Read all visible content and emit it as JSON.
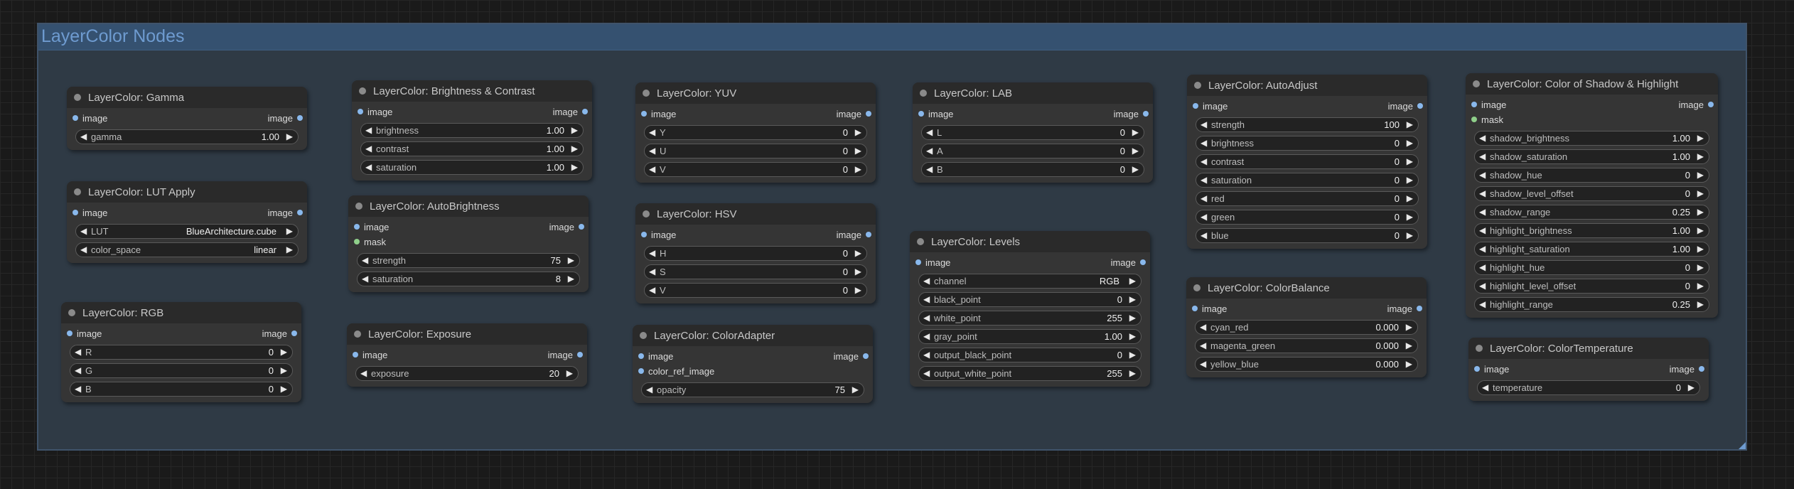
{
  "group": {
    "title": "LayerColor Nodes",
    "color": "#355170"
  },
  "nodes": {
    "gamma": {
      "title": "LayerColor: Gamma",
      "inputs": [
        {
          "label": "image",
          "color": "blue"
        }
      ],
      "output": "image",
      "widgets": [
        {
          "name": "gamma",
          "value": "1.00"
        }
      ]
    },
    "lut": {
      "title": "LayerColor: LUT Apply",
      "inputs": [
        {
          "label": "image",
          "color": "blue"
        }
      ],
      "output": "image",
      "widgets": [
        {
          "name": "LUT",
          "value": "BlueArchitecture.cube"
        },
        {
          "name": "color_space",
          "value": "linear"
        }
      ]
    },
    "rgb": {
      "title": "LayerColor: RGB",
      "inputs": [
        {
          "label": "image",
          "color": "blue"
        }
      ],
      "output": "image",
      "widgets": [
        {
          "name": "R",
          "value": "0"
        },
        {
          "name": "G",
          "value": "0"
        },
        {
          "name": "B",
          "value": "0"
        }
      ]
    },
    "brightness_contrast": {
      "title": "LayerColor: Brightness & Contrast",
      "inputs": [
        {
          "label": "image",
          "color": "blue"
        }
      ],
      "output": "image",
      "widgets": [
        {
          "name": "brightness",
          "value": "1.00"
        },
        {
          "name": "contrast",
          "value": "1.00"
        },
        {
          "name": "saturation",
          "value": "1.00"
        }
      ]
    },
    "autobrightness": {
      "title": "LayerColor: AutoBrightness",
      "inputs": [
        {
          "label": "image",
          "color": "blue"
        },
        {
          "label": "mask",
          "color": "green"
        }
      ],
      "output": "image",
      "widgets": [
        {
          "name": "strength",
          "value": "75"
        },
        {
          "name": "saturation",
          "value": "8"
        }
      ]
    },
    "exposure": {
      "title": "LayerColor: Exposure",
      "inputs": [
        {
          "label": "image",
          "color": "blue"
        }
      ],
      "output": "image",
      "widgets": [
        {
          "name": "exposure",
          "value": "20"
        }
      ]
    },
    "yuv": {
      "title": "LayerColor: YUV",
      "inputs": [
        {
          "label": "image",
          "color": "blue"
        }
      ],
      "output": "image",
      "widgets": [
        {
          "name": "Y",
          "value": "0"
        },
        {
          "name": "U",
          "value": "0"
        },
        {
          "name": "V",
          "value": "0"
        }
      ]
    },
    "hsv": {
      "title": "LayerColor: HSV",
      "inputs": [
        {
          "label": "image",
          "color": "blue"
        }
      ],
      "output": "image",
      "widgets": [
        {
          "name": "H",
          "value": "0"
        },
        {
          "name": "S",
          "value": "0"
        },
        {
          "name": "V",
          "value": "0"
        }
      ]
    },
    "coloradapter": {
      "title": "LayerColor: ColorAdapter",
      "inputs": [
        {
          "label": "image",
          "color": "blue"
        },
        {
          "label": "color_ref_image",
          "color": "blue"
        }
      ],
      "output": "image",
      "widgets": [
        {
          "name": "opacity",
          "value": "75"
        }
      ]
    },
    "lab": {
      "title": "LayerColor: LAB",
      "inputs": [
        {
          "label": "image",
          "color": "blue"
        }
      ],
      "output": "image",
      "widgets": [
        {
          "name": "L",
          "value": "0"
        },
        {
          "name": "A",
          "value": "0"
        },
        {
          "name": "B",
          "value": "0"
        }
      ]
    },
    "levels": {
      "title": "LayerColor: Levels",
      "inputs": [
        {
          "label": "image",
          "color": "blue"
        }
      ],
      "output": "image",
      "widgets": [
        {
          "name": "channel",
          "value": "RGB"
        },
        {
          "name": "black_point",
          "value": "0"
        },
        {
          "name": "white_point",
          "value": "255"
        },
        {
          "name": "gray_point",
          "value": "1.00"
        },
        {
          "name": "output_black_point",
          "value": "0"
        },
        {
          "name": "output_white_point",
          "value": "255"
        }
      ]
    },
    "autoadjust": {
      "title": "LayerColor: AutoAdjust",
      "inputs": [
        {
          "label": "image",
          "color": "blue"
        }
      ],
      "output": "image",
      "widgets": [
        {
          "name": "strength",
          "value": "100"
        },
        {
          "name": "brightness",
          "value": "0"
        },
        {
          "name": "contrast",
          "value": "0"
        },
        {
          "name": "saturation",
          "value": "0"
        },
        {
          "name": "red",
          "value": "0"
        },
        {
          "name": "green",
          "value": "0"
        },
        {
          "name": "blue",
          "value": "0"
        }
      ]
    },
    "colorbalance": {
      "title": "LayerColor: ColorBalance",
      "inputs": [
        {
          "label": "image",
          "color": "blue"
        }
      ],
      "output": "image",
      "widgets": [
        {
          "name": "cyan_red",
          "value": "0.000"
        },
        {
          "name": "magenta_green",
          "value": "0.000"
        },
        {
          "name": "yellow_blue",
          "value": "0.000"
        }
      ]
    },
    "shadow_highlight": {
      "title": "LayerColor: Color of Shadow & Highlight",
      "inputs": [
        {
          "label": "image",
          "color": "blue"
        },
        {
          "label": "mask",
          "color": "green"
        }
      ],
      "output": "image",
      "widgets": [
        {
          "name": "shadow_brightness",
          "value": "1.00"
        },
        {
          "name": "shadow_saturation",
          "value": "1.00"
        },
        {
          "name": "shadow_hue",
          "value": "0"
        },
        {
          "name": "shadow_level_offset",
          "value": "0"
        },
        {
          "name": "shadow_range",
          "value": "0.25"
        },
        {
          "name": "highlight_brightness",
          "value": "1.00"
        },
        {
          "name": "highlight_saturation",
          "value": "1.00"
        },
        {
          "name": "highlight_hue",
          "value": "0"
        },
        {
          "name": "highlight_level_offset",
          "value": "0"
        },
        {
          "name": "highlight_range",
          "value": "0.25"
        }
      ]
    },
    "colortemperature": {
      "title": "LayerColor: ColorTemperature",
      "inputs": [
        {
          "label": "image",
          "color": "blue"
        }
      ],
      "output": "image",
      "widgets": [
        {
          "name": "temperature",
          "value": "0"
        }
      ]
    }
  }
}
